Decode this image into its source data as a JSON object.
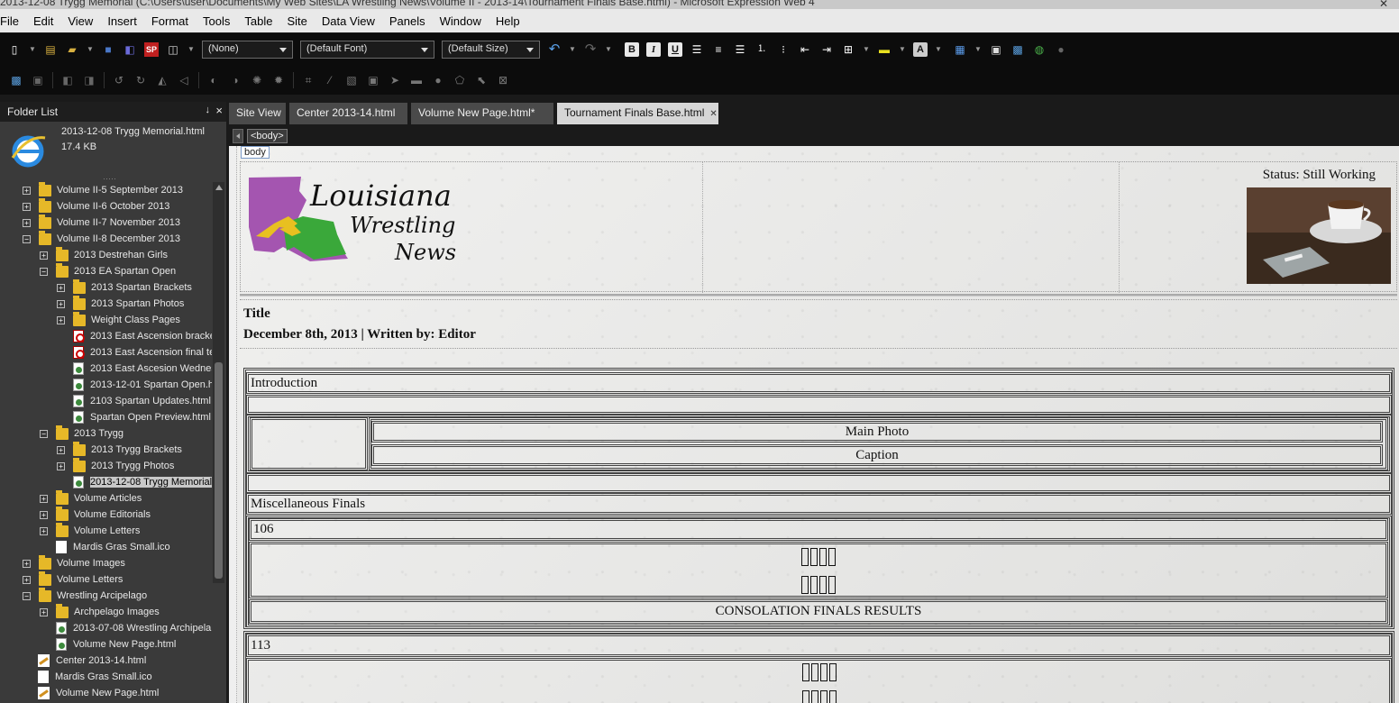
{
  "titlebar": {
    "text": "2013-12-08 Trygg Memorial (C:\\Users\\user\\Documents\\My Web Sites\\LA Wrestling News\\Volume II - 2013-14\\Tournament Finals Base.html) - Microsoft Expression Web 4"
  },
  "menu": [
    "File",
    "Edit",
    "View",
    "Insert",
    "Format",
    "Tools",
    "Table",
    "Site",
    "Data View",
    "Panels",
    "Window",
    "Help"
  ],
  "toolbar": {
    "style_value": "(None)",
    "font_value": "(Default Font)",
    "size_value": "(Default Size)",
    "bold": "B",
    "italic": "I",
    "underline": "U",
    "font_color_letter": "A"
  },
  "sidebar": {
    "title": "Folder List",
    "pin": "↓",
    "close": "×",
    "current_file": {
      "name": "2013-12-08 Trygg Memorial.html",
      "size": "17.4 KB"
    },
    "items": [
      {
        "label": "Volume II-5 September 2013",
        "type": "folder",
        "level": 0,
        "exp": "+"
      },
      {
        "label": "Volume II-6 October 2013",
        "type": "folder",
        "level": 0,
        "exp": "+"
      },
      {
        "label": "Volume II-7 November 2013",
        "type": "folder",
        "level": 0,
        "exp": "+"
      },
      {
        "label": "Volume II-8 December 2013",
        "type": "folder",
        "level": 0,
        "exp": "−"
      },
      {
        "label": "2013 Destrehan Girls",
        "type": "folder",
        "level": 1,
        "exp": "+"
      },
      {
        "label": "2013 EA Spartan Open",
        "type": "folder",
        "level": 1,
        "exp": "−"
      },
      {
        "label": "2013 Spartan Brackets",
        "type": "folder",
        "level": 2,
        "exp": "+"
      },
      {
        "label": "2013 Spartan Photos",
        "type": "folder",
        "level": 2,
        "exp": "+"
      },
      {
        "label": "Weight Class Pages",
        "type": "folder",
        "level": 2,
        "exp": "+"
      },
      {
        "label": "2013 East Ascension bracke",
        "type": "pdf",
        "level": 2,
        "exp": ""
      },
      {
        "label": "2013 East Ascension final te",
        "type": "pdf",
        "level": 2,
        "exp": ""
      },
      {
        "label": "2013 East Ascesion Wednes",
        "type": "html",
        "level": 2,
        "exp": ""
      },
      {
        "label": "2013-12-01 Spartan Open.h",
        "type": "html",
        "level": 2,
        "exp": ""
      },
      {
        "label": "2103 Spartan Updates.html",
        "type": "html",
        "level": 2,
        "exp": ""
      },
      {
        "label": "Spartan Open Preview.html",
        "type": "html",
        "level": 2,
        "exp": ""
      },
      {
        "label": "2013 Trygg",
        "type": "folder",
        "level": 1,
        "exp": "−"
      },
      {
        "label": "2013 Trygg Brackets",
        "type": "folder",
        "level": 2,
        "exp": "+"
      },
      {
        "label": "2013 Trygg Photos",
        "type": "folder",
        "level": 2,
        "exp": "+"
      },
      {
        "label": "2013-12-08 Trygg Memorial",
        "type": "html",
        "level": 2,
        "exp": "",
        "selected": true
      },
      {
        "label": "Volume Articles",
        "type": "folder",
        "level": 1,
        "exp": "+"
      },
      {
        "label": "Volume Editorials",
        "type": "folder",
        "level": 1,
        "exp": "+"
      },
      {
        "label": "Volume Letters",
        "type": "folder",
        "level": 1,
        "exp": "+"
      },
      {
        "label": "Mardis Gras Small.ico",
        "type": "ico",
        "level": 1,
        "exp": ""
      },
      {
        "label": "Volume Images",
        "type": "folder",
        "level": 0,
        "exp": "+"
      },
      {
        "label": "Volume Letters",
        "type": "folder",
        "level": 0,
        "exp": "+"
      },
      {
        "label": "Wrestling Arcipelago",
        "type": "folder",
        "level": 0,
        "exp": "−"
      },
      {
        "label": "Archpelago Images",
        "type": "folder",
        "level": 1,
        "exp": "+"
      },
      {
        "label": "2013-07-08 Wrestling Archipela",
        "type": "html",
        "level": 1,
        "exp": ""
      },
      {
        "label": "Volume New Page.html",
        "type": "html",
        "level": 1,
        "exp": ""
      },
      {
        "label": "Center 2013-14.html",
        "type": "edit",
        "level": -1,
        "exp": ""
      },
      {
        "label": "Mardis Gras Small.ico",
        "type": "ico",
        "level": -1,
        "exp": ""
      },
      {
        "label": "Volume New Page.html",
        "type": "edit",
        "level": -1,
        "exp": ""
      }
    ]
  },
  "tabs": [
    {
      "label": "Site View",
      "active": false
    },
    {
      "label": "Center 2013-14.html",
      "active": false
    },
    {
      "label": "Volume New Page.html*",
      "active": false
    },
    {
      "label": "Tournament Finals Base.html",
      "active": true
    }
  ],
  "quicktag": {
    "tag": "<body>",
    "body_label": "body"
  },
  "page": {
    "logo_line1": "Louisiana",
    "logo_line2": "Wrestling",
    "logo_line3": "News",
    "status": "Status: Still Working",
    "title": "Title",
    "byline": "December 8th, 2013 | Written by: Editor",
    "introduction": "Introduction",
    "main_photo": "Main Photo",
    "caption": "Caption",
    "misc_finals": "Miscellaneous Finals",
    "weight_1": "106",
    "consolation": "CONSOLATION FINALS RESULTS",
    "weight_2": "113"
  },
  "colors": {
    "logo_purple": "#a455b0",
    "logo_green": "#3aa83a",
    "logo_yellow": "#e8c020",
    "folder": "#e6b828"
  }
}
